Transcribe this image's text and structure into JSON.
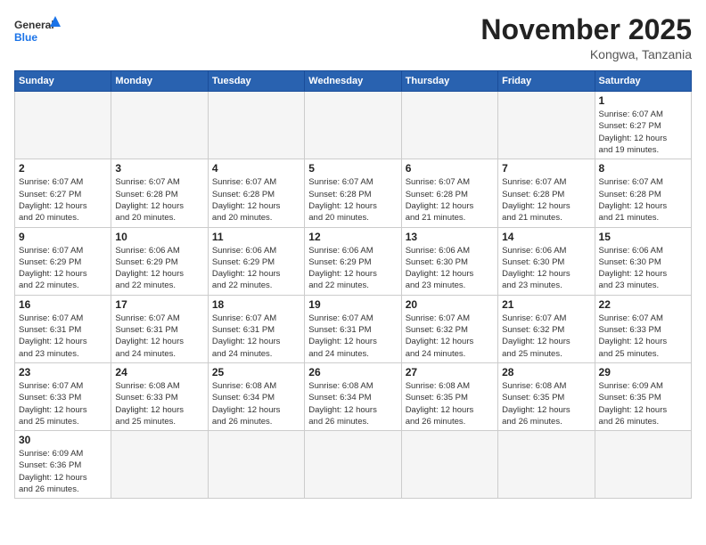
{
  "logo": {
    "text_general": "General",
    "text_blue": "Blue"
  },
  "header": {
    "month_title": "November 2025",
    "location": "Kongwa, Tanzania"
  },
  "days_of_week": [
    "Sunday",
    "Monday",
    "Tuesday",
    "Wednesday",
    "Thursday",
    "Friday",
    "Saturday"
  ],
  "weeks": [
    [
      {
        "day": "",
        "info": ""
      },
      {
        "day": "",
        "info": ""
      },
      {
        "day": "",
        "info": ""
      },
      {
        "day": "",
        "info": ""
      },
      {
        "day": "",
        "info": ""
      },
      {
        "day": "",
        "info": ""
      },
      {
        "day": "1",
        "info": "Sunrise: 6:07 AM\nSunset: 6:27 PM\nDaylight: 12 hours\nand 19 minutes."
      }
    ],
    [
      {
        "day": "2",
        "info": "Sunrise: 6:07 AM\nSunset: 6:27 PM\nDaylight: 12 hours\nand 20 minutes."
      },
      {
        "day": "3",
        "info": "Sunrise: 6:07 AM\nSunset: 6:28 PM\nDaylight: 12 hours\nand 20 minutes."
      },
      {
        "day": "4",
        "info": "Sunrise: 6:07 AM\nSunset: 6:28 PM\nDaylight: 12 hours\nand 20 minutes."
      },
      {
        "day": "5",
        "info": "Sunrise: 6:07 AM\nSunset: 6:28 PM\nDaylight: 12 hours\nand 20 minutes."
      },
      {
        "day": "6",
        "info": "Sunrise: 6:07 AM\nSunset: 6:28 PM\nDaylight: 12 hours\nand 21 minutes."
      },
      {
        "day": "7",
        "info": "Sunrise: 6:07 AM\nSunset: 6:28 PM\nDaylight: 12 hours\nand 21 minutes."
      },
      {
        "day": "8",
        "info": "Sunrise: 6:07 AM\nSunset: 6:28 PM\nDaylight: 12 hours\nand 21 minutes."
      }
    ],
    [
      {
        "day": "9",
        "info": "Sunrise: 6:07 AM\nSunset: 6:29 PM\nDaylight: 12 hours\nand 22 minutes."
      },
      {
        "day": "10",
        "info": "Sunrise: 6:06 AM\nSunset: 6:29 PM\nDaylight: 12 hours\nand 22 minutes."
      },
      {
        "day": "11",
        "info": "Sunrise: 6:06 AM\nSunset: 6:29 PM\nDaylight: 12 hours\nand 22 minutes."
      },
      {
        "day": "12",
        "info": "Sunrise: 6:06 AM\nSunset: 6:29 PM\nDaylight: 12 hours\nand 22 minutes."
      },
      {
        "day": "13",
        "info": "Sunrise: 6:06 AM\nSunset: 6:30 PM\nDaylight: 12 hours\nand 23 minutes."
      },
      {
        "day": "14",
        "info": "Sunrise: 6:06 AM\nSunset: 6:30 PM\nDaylight: 12 hours\nand 23 minutes."
      },
      {
        "day": "15",
        "info": "Sunrise: 6:06 AM\nSunset: 6:30 PM\nDaylight: 12 hours\nand 23 minutes."
      }
    ],
    [
      {
        "day": "16",
        "info": "Sunrise: 6:07 AM\nSunset: 6:31 PM\nDaylight: 12 hours\nand 23 minutes."
      },
      {
        "day": "17",
        "info": "Sunrise: 6:07 AM\nSunset: 6:31 PM\nDaylight: 12 hours\nand 24 minutes."
      },
      {
        "day": "18",
        "info": "Sunrise: 6:07 AM\nSunset: 6:31 PM\nDaylight: 12 hours\nand 24 minutes."
      },
      {
        "day": "19",
        "info": "Sunrise: 6:07 AM\nSunset: 6:31 PM\nDaylight: 12 hours\nand 24 minutes."
      },
      {
        "day": "20",
        "info": "Sunrise: 6:07 AM\nSunset: 6:32 PM\nDaylight: 12 hours\nand 24 minutes."
      },
      {
        "day": "21",
        "info": "Sunrise: 6:07 AM\nSunset: 6:32 PM\nDaylight: 12 hours\nand 25 minutes."
      },
      {
        "day": "22",
        "info": "Sunrise: 6:07 AM\nSunset: 6:33 PM\nDaylight: 12 hours\nand 25 minutes."
      }
    ],
    [
      {
        "day": "23",
        "info": "Sunrise: 6:07 AM\nSunset: 6:33 PM\nDaylight: 12 hours\nand 25 minutes."
      },
      {
        "day": "24",
        "info": "Sunrise: 6:08 AM\nSunset: 6:33 PM\nDaylight: 12 hours\nand 25 minutes."
      },
      {
        "day": "25",
        "info": "Sunrise: 6:08 AM\nSunset: 6:34 PM\nDaylight: 12 hours\nand 26 minutes."
      },
      {
        "day": "26",
        "info": "Sunrise: 6:08 AM\nSunset: 6:34 PM\nDaylight: 12 hours\nand 26 minutes."
      },
      {
        "day": "27",
        "info": "Sunrise: 6:08 AM\nSunset: 6:35 PM\nDaylight: 12 hours\nand 26 minutes."
      },
      {
        "day": "28",
        "info": "Sunrise: 6:08 AM\nSunset: 6:35 PM\nDaylight: 12 hours\nand 26 minutes."
      },
      {
        "day": "29",
        "info": "Sunrise: 6:09 AM\nSunset: 6:35 PM\nDaylight: 12 hours\nand 26 minutes."
      }
    ],
    [
      {
        "day": "30",
        "info": "Sunrise: 6:09 AM\nSunset: 6:36 PM\nDaylight: 12 hours\nand 26 minutes."
      },
      {
        "day": "",
        "info": ""
      },
      {
        "day": "",
        "info": ""
      },
      {
        "day": "",
        "info": ""
      },
      {
        "day": "",
        "info": ""
      },
      {
        "day": "",
        "info": ""
      },
      {
        "day": "",
        "info": ""
      }
    ]
  ]
}
